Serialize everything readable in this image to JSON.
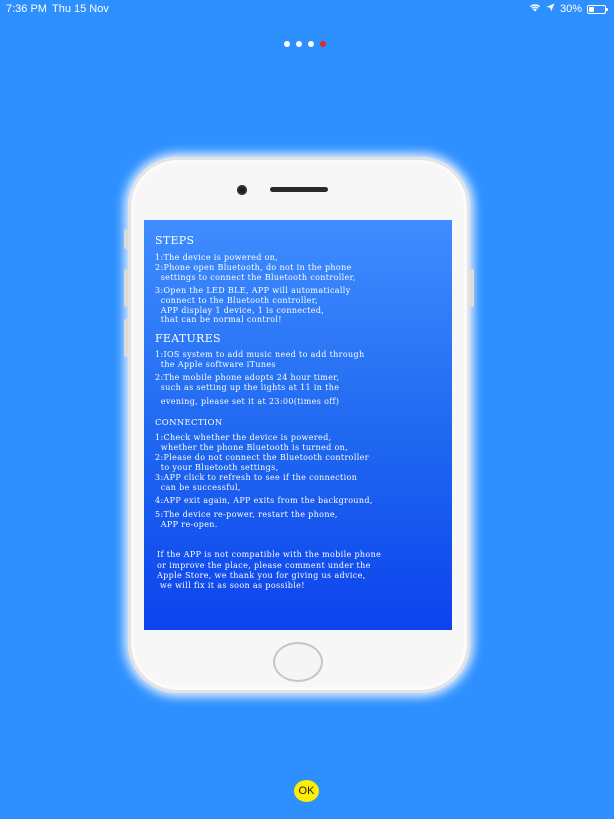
{
  "status_bar": {
    "time": "7:36 PM",
    "date": "Thu 15 Nov",
    "battery_percent": "30%",
    "battery_level": 0.3,
    "icons": [
      "wifi-icon",
      "location-icon",
      "battery-icon"
    ]
  },
  "pager": {
    "total": 4,
    "active_index": 3,
    "active_color": "#e8252a"
  },
  "instructions": {
    "steps_title": "STEPS",
    "steps": [
      "1:The device is powered on,",
      "2:Phone open Bluetooth, do not in the phone",
      "  settings to connect the Bluetooth controller,",
      "3:Open the LED BLE, APP will automatically",
      "  connect to the Bluetooth controller,",
      "  APP display 1 device, 1 is connected,",
      "  that can be normal control!"
    ],
    "features_title": "FEATURES",
    "features": [
      "1:IOS system to add music need to add through",
      "  the Apple software iTunes",
      "2:The mobile phone adopts 24 hour timer,",
      "  such as setting up the lights at 11 in the",
      "  evening, please set it at 23:00(times off)"
    ],
    "connection_title": "CONNECTION",
    "connection": [
      "1:Check whether the device is powered,",
      "  whether the phone Bluetooth is turned on,",
      "2:Please do not connect the Bluetooth controller",
      "  to your Bluetooth settings,",
      "3:APP click to refresh to see if the connection",
      "  can be successful,",
      "4:APP exit again, APP exits from the background,",
      "5:The device re-power, restart the phone,",
      "  APP re-open."
    ],
    "footer": [
      "If the APP is not compatible with the mobile phone",
      "or improve the place, please comment under the",
      "Apple Store, we thank you for giving us advice,",
      " we will fix it as soon as possible!"
    ]
  },
  "ok_button": {
    "label": "OK",
    "color": "#ffee00"
  },
  "colors": {
    "background": "#2e90ff",
    "screen_top": "#3f8dff",
    "screen_bottom": "#0d43ee"
  }
}
